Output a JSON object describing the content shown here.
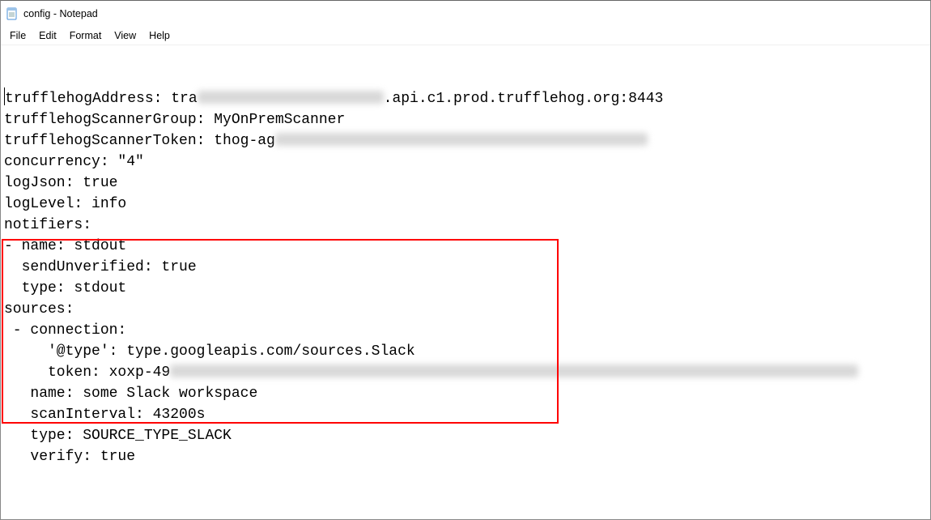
{
  "window": {
    "title": "config - Notepad"
  },
  "menu": {
    "file": "File",
    "edit": "Edit",
    "format": "Format",
    "view": "View",
    "help": "Help"
  },
  "config": {
    "lines": [
      {
        "prefix": "trufflehogAddress: tra",
        "blurred_width": 230,
        "suffix": ".api.c1.prod.trufflehog.org:8443"
      },
      {
        "text": "trufflehogScannerGroup: MyOnPremScanner"
      },
      {
        "prefix": "trufflehogScannerToken: thog-ag",
        "blurred_width": 460,
        "suffix": ""
      },
      {
        "text": "concurrency: \"4\""
      },
      {
        "text": "logJson: true"
      },
      {
        "text": "logLevel: info"
      },
      {
        "text": "notifiers:"
      },
      {
        "text": "- name: stdout"
      },
      {
        "text": "  sendUnverified: true"
      },
      {
        "text": "  type: stdout"
      },
      {
        "text": "sources:"
      },
      {
        "text": " - connection:"
      },
      {
        "text": "     '@type': type.googleapis.com/sources.Slack"
      },
      {
        "prefix": "     token: xoxp-49",
        "blurred_width": 850,
        "suffix": ""
      },
      {
        "text": "   name: some Slack workspace"
      },
      {
        "text": "   scanInterval: 43200s"
      },
      {
        "text": "   type: SOURCE_TYPE_SLACK"
      },
      {
        "text": "   verify: true"
      }
    ]
  }
}
